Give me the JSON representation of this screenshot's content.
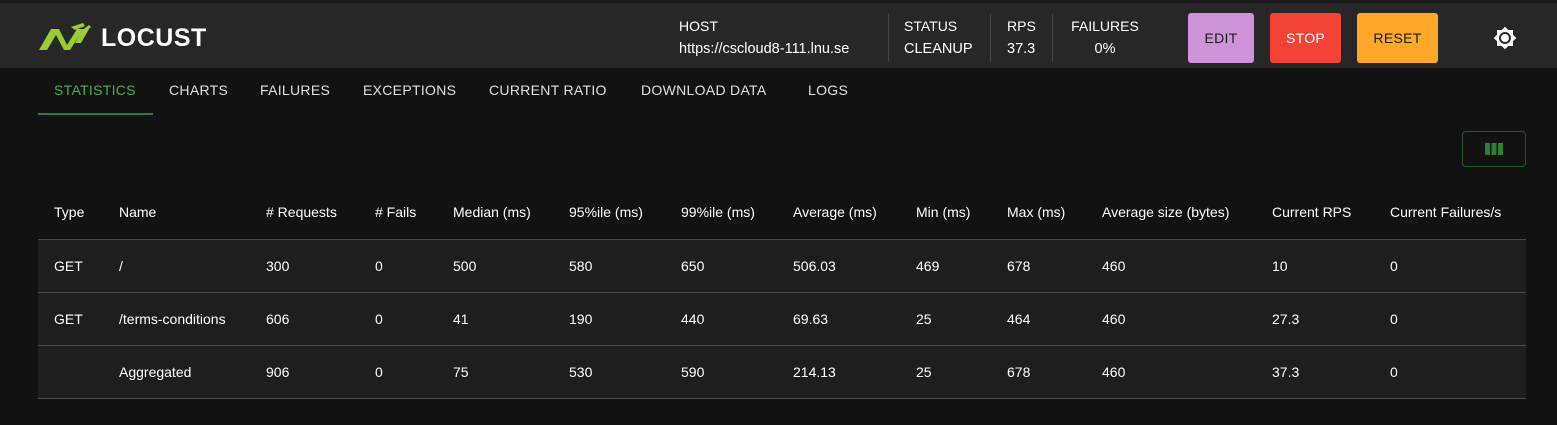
{
  "app": {
    "name": "LOCUST"
  },
  "colors": {
    "accent": "#4caf50",
    "logo": "#9acd32",
    "edit": "#ce93d8",
    "stop": "#f44336",
    "reset": "#ffa726"
  },
  "header": {
    "host_label": "HOST",
    "host_value": "https://cscloud8-111.lnu.se",
    "status_label": "STATUS",
    "status_value": "CLEANUP",
    "rps_label": "RPS",
    "rps_value": "37.3",
    "failures_label": "FAILURES",
    "failures_value": "0%",
    "edit_label": "EDIT",
    "stop_label": "STOP",
    "reset_label": "RESET",
    "theme_icon": "brightness-icon"
  },
  "tabs": [
    {
      "label": "STATISTICS",
      "active": true
    },
    {
      "label": "CHARTS"
    },
    {
      "label": "FAILURES"
    },
    {
      "label": "EXCEPTIONS"
    },
    {
      "label": "CURRENT RATIO"
    },
    {
      "label": "DOWNLOAD DATA"
    },
    {
      "label": "LOGS"
    }
  ],
  "columns_button_icon": "view-column-icon",
  "table": {
    "headers": [
      "Type",
      "Name",
      "# Requests",
      "# Fails",
      "Median (ms)",
      "95%ile (ms)",
      "99%ile (ms)",
      "Average (ms)",
      "Min (ms)",
      "Max (ms)",
      "Average size (bytes)",
      "Current RPS",
      "Current Failures/s"
    ],
    "rows": [
      [
        "GET",
        "/",
        "300",
        "0",
        "500",
        "580",
        "650",
        "506.03",
        "469",
        "678",
        "460",
        "10",
        "0"
      ],
      [
        "GET",
        "/terms-conditions",
        "606",
        "0",
        "41",
        "190",
        "440",
        "69.63",
        "25",
        "464",
        "460",
        "27.3",
        "0"
      ],
      [
        "",
        "Aggregated",
        "906",
        "0",
        "75",
        "530",
        "590",
        "214.13",
        "25",
        "678",
        "460",
        "37.3",
        "0"
      ]
    ]
  }
}
